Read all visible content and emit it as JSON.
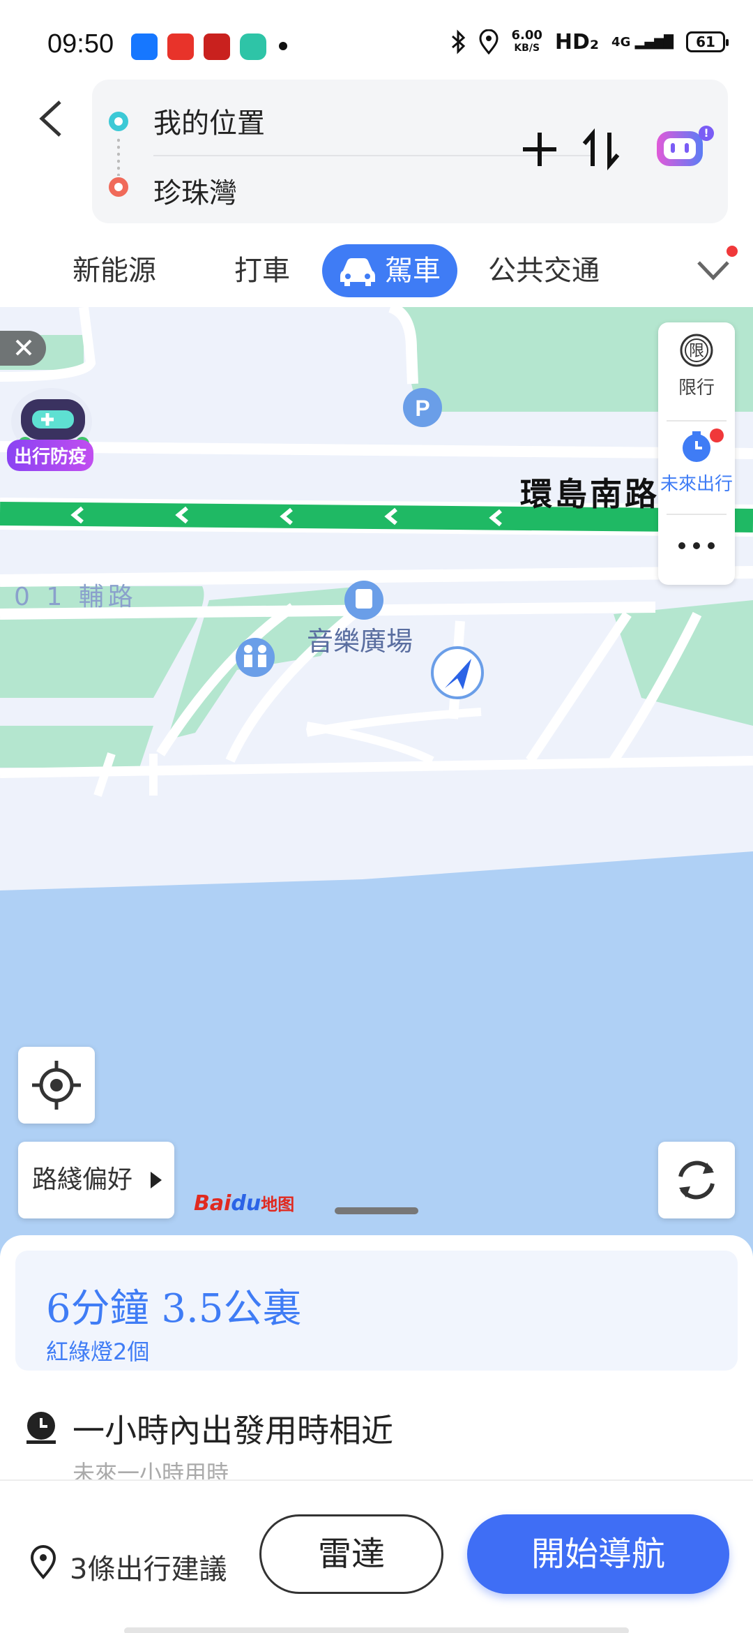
{
  "status_bar": {
    "time": "09:50",
    "network_speed": "6.00",
    "network_unit": "KB/S",
    "hd": "HD₂",
    "network_type": "4G",
    "battery": "61"
  },
  "route": {
    "start": "我的位置",
    "destination": "珍珠灣"
  },
  "tabs": [
    {
      "label": "新能源"
    },
    {
      "label": "打車"
    },
    {
      "label": "駕車",
      "active": true
    },
    {
      "label": "公共交通"
    }
  ],
  "map": {
    "road_main": "環島南路",
    "road_side": "0 1 輔路",
    "poi_plaza": "音樂廣場",
    "right_panel": {
      "restrict_icon_text": "限",
      "restrict_label": "限行",
      "future_label": "未來出行"
    },
    "epidemic_label": "出行防疫",
    "route_pref_label": "路綫偏好",
    "logo_text": "Bai",
    "logo_du": "du",
    "logo_map": "地图"
  },
  "summary": {
    "time_distance": "6分鐘  3.5公裏",
    "traffic_lights": "紅綠燈2個"
  },
  "future_travel": {
    "title": "一小時內出發用時相近",
    "subtitle": "未來一小時用時"
  },
  "actions": {
    "suggestions": "3條出行建議",
    "radar": "雷達",
    "start_nav": "開始導航"
  },
  "colors": {
    "accent": "#3f7cf5",
    "road_green": "#1fb964",
    "water": "#afd0f5",
    "park": "#b4e6cf"
  }
}
